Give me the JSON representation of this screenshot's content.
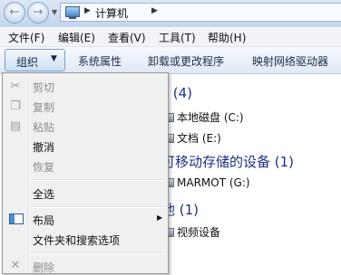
{
  "address": {
    "crumb": "计算机"
  },
  "menubar": [
    "文件(F)",
    "编辑(E)",
    "查看(V)",
    "工具(T)",
    "帮助(H)"
  ],
  "commandbar": {
    "organize": "组织",
    "items": [
      "系统属性",
      "卸载或更改程序",
      "映射网络驱动器"
    ]
  },
  "content": {
    "groups": [
      {
        "header": "硬盘 (4)",
        "items": [
          "本地磁盘 (C:)",
          "文档 (E:)"
        ]
      },
      {
        "header": "有可移动存储的设备 (1)",
        "items": [
          "MARMOT (G:)"
        ]
      },
      {
        "header": "其他 (1)",
        "items": [
          "视频设备"
        ]
      }
    ]
  },
  "organize_menu": {
    "cut": "剪切",
    "copy": "复制",
    "paste": "粘贴",
    "undo": "撤消",
    "redo": "恢复",
    "select_all": "全选",
    "layout": "布局",
    "folder_options": "文件夹和搜索选项",
    "delete": "删除"
  }
}
